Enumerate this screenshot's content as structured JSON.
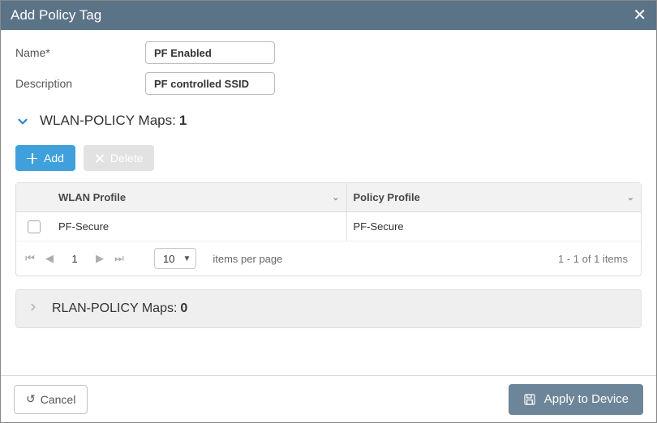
{
  "modal": {
    "title": "Add Policy Tag"
  },
  "form": {
    "name_label": "Name*",
    "name_value": "PF Enabled",
    "desc_label": "Description",
    "desc_value": "PF controlled SSID"
  },
  "wlan_section": {
    "title_prefix": "WLAN-POLICY Maps: ",
    "count": "1",
    "add_label": "Add",
    "delete_label": "Delete",
    "columns": {
      "wlan": "WLAN Profile",
      "policy": "Policy Profile"
    },
    "rows": [
      {
        "wlan": "PF-Secure",
        "policy": "PF-Secure"
      }
    ],
    "pager": {
      "current": "1",
      "page_size": "10",
      "per_page_label": "items per page",
      "range": "1 - 1 of 1 items"
    }
  },
  "rlan_section": {
    "title_prefix": "RLAN-POLICY Maps: ",
    "count": "0"
  },
  "footer": {
    "cancel": "Cancel",
    "apply": "Apply to Device"
  }
}
